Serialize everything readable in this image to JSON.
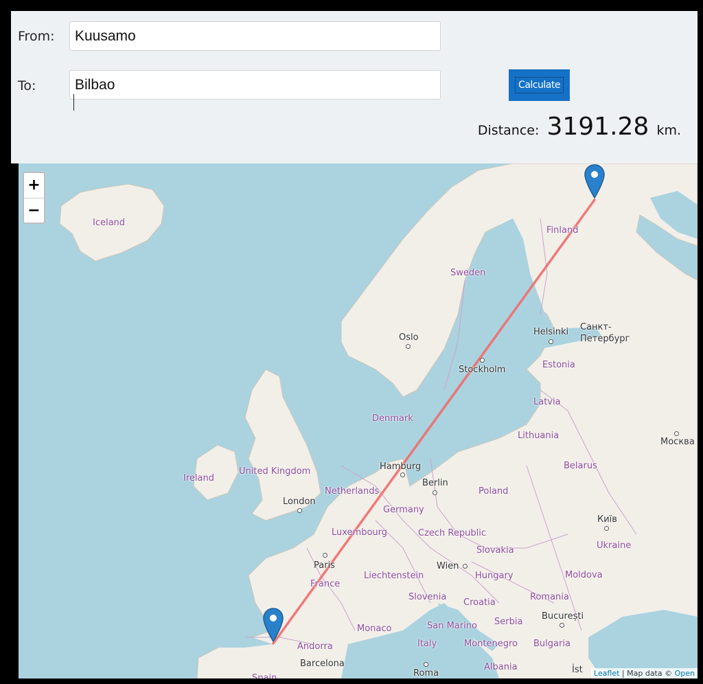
{
  "form": {
    "from_label": "From:",
    "from_value": "Kuusamo",
    "to_label": "To:",
    "to_value": "Bilbao",
    "calculate_label": "Calculate"
  },
  "result": {
    "label": "Distance:",
    "value": "3191.28",
    "unit": "km."
  },
  "map": {
    "zoom_in": "+",
    "zoom_out": "−",
    "route_color": "#f06b6b",
    "marker_color": "#2a81cb",
    "countries": {
      "iceland": "Iceland",
      "finland": "Finland",
      "sweden": "Sweden",
      "estonia": "Estonia",
      "latvia": "Latvia",
      "lithuania": "Lithuania",
      "belarus": "Belarus",
      "denmark": "Denmark",
      "ireland": "Ireland",
      "uk": "United Kingdom",
      "netherlands": "Netherlands",
      "germany": "Germany",
      "poland": "Poland",
      "luxembourg": "Luxembourg",
      "czech": "Czech Republic",
      "slovakia": "Slovakia",
      "ukraine": "Ukraine",
      "france": "France",
      "liechtenstein": "Liechtenstein",
      "hungary": "Hungary",
      "moldova": "Moldova",
      "slovenia": "Slovenia",
      "croatia": "Croatia",
      "romania": "Romania",
      "monaco": "Monaco",
      "sanmarino": "San Marino",
      "serbia": "Serbia",
      "andorra": "Andorra",
      "italy": "Italy",
      "montenegro": "Montenegro",
      "bulgaria": "Bulgaria",
      "albania": "Albania",
      "spain": "Spain"
    },
    "cities": {
      "helsinki": "Helsinki",
      "spb": "Санкт-\nПетербург",
      "oslo": "Oslo",
      "stockholm": "Stockholm",
      "moscow": "Москва",
      "hamburg": "Hamburg",
      "berlin": "Berlin",
      "london": "London",
      "kyiv": "Київ",
      "paris": "Paris",
      "wien": "Wien",
      "bucuresti": "București",
      "barcelona": "Barcelona",
      "roma": "Roma",
      "ist": "İst"
    },
    "attribution": {
      "leaflet": "Leaflet",
      "sep": " | Map data © ",
      "osm": "Open"
    }
  }
}
